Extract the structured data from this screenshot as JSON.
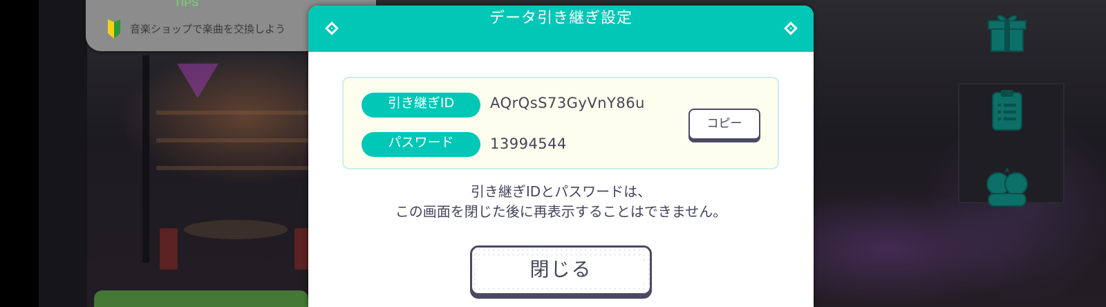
{
  "hint": {
    "tag": "TIPS",
    "text": "音楽ショップで楽曲を交換しよう"
  },
  "dialog": {
    "title": "データ引き継ぎ設定",
    "id_label": "引き継ぎID",
    "id_value": "AQrQsS73GyVnY86u",
    "password_label": "パスワード",
    "password_value": "13994544",
    "copy_label": "コピー",
    "notice_line1": "引き継ぎIDとパスワードは、",
    "notice_line2": "この画面を閉じた後に再表示することはできません。",
    "close_label": "閉じる"
  },
  "side_icons": [
    "gift-icon",
    "mission-clipboard-icon",
    "friends-icon"
  ],
  "colors": {
    "accent": "#00c7b6",
    "text": "#44445a",
    "info_bg": "#fefeee",
    "button_border": "#4b4964"
  }
}
